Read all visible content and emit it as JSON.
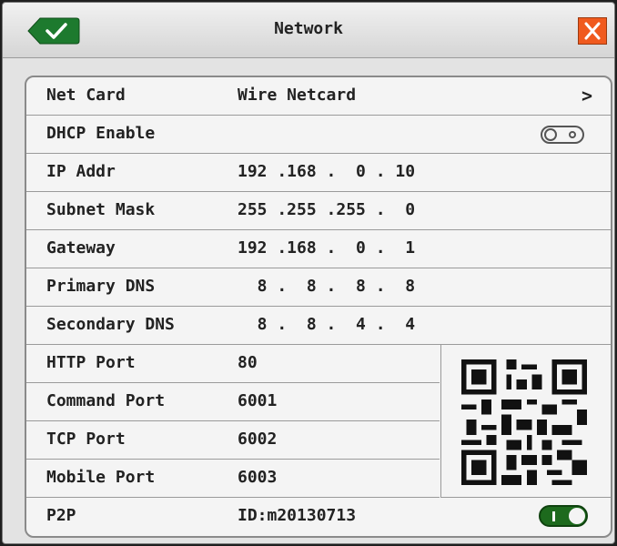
{
  "window": {
    "title": "Network"
  },
  "colors": {
    "ok_green": "#1d7a2e",
    "close_orange": "#f05a1e",
    "toggle_green": "#1d6a1d"
  },
  "icons": {
    "ok": "checkmark-icon",
    "close": "close-icon",
    "arrow": "chevron-right-icon",
    "qr": "qr-code"
  },
  "settings": {
    "net_card": {
      "label": "Net Card",
      "value": "Wire Netcard",
      "arrow": ">"
    },
    "dhcp": {
      "label": "DHCP Enable",
      "enabled": false
    },
    "ip_addr": {
      "label": "IP Addr",
      "value": "192 .168 .  0 . 10"
    },
    "subnet_mask": {
      "label": "Subnet Mask",
      "value": "255 .255 .255 .  0"
    },
    "gateway": {
      "label": "Gateway",
      "value": "192 .168 .  0 .  1"
    },
    "primary_dns": {
      "label": "Primary DNS",
      "value": "  8 .  8 .  8 .  8"
    },
    "secondary_dns": {
      "label": "Secondary DNS",
      "value": "  8 .  8 .  4 .  4"
    },
    "http_port": {
      "label": "HTTP Port",
      "value": "80"
    },
    "command_port": {
      "label": "Command Port",
      "value": "6001"
    },
    "tcp_port": {
      "label": "TCP Port",
      "value": "6002"
    },
    "mobile_port": {
      "label": "Mobile Port",
      "value": "6003"
    },
    "p2p": {
      "label": "P2P",
      "value": "ID:m20130713",
      "enabled": true
    }
  }
}
